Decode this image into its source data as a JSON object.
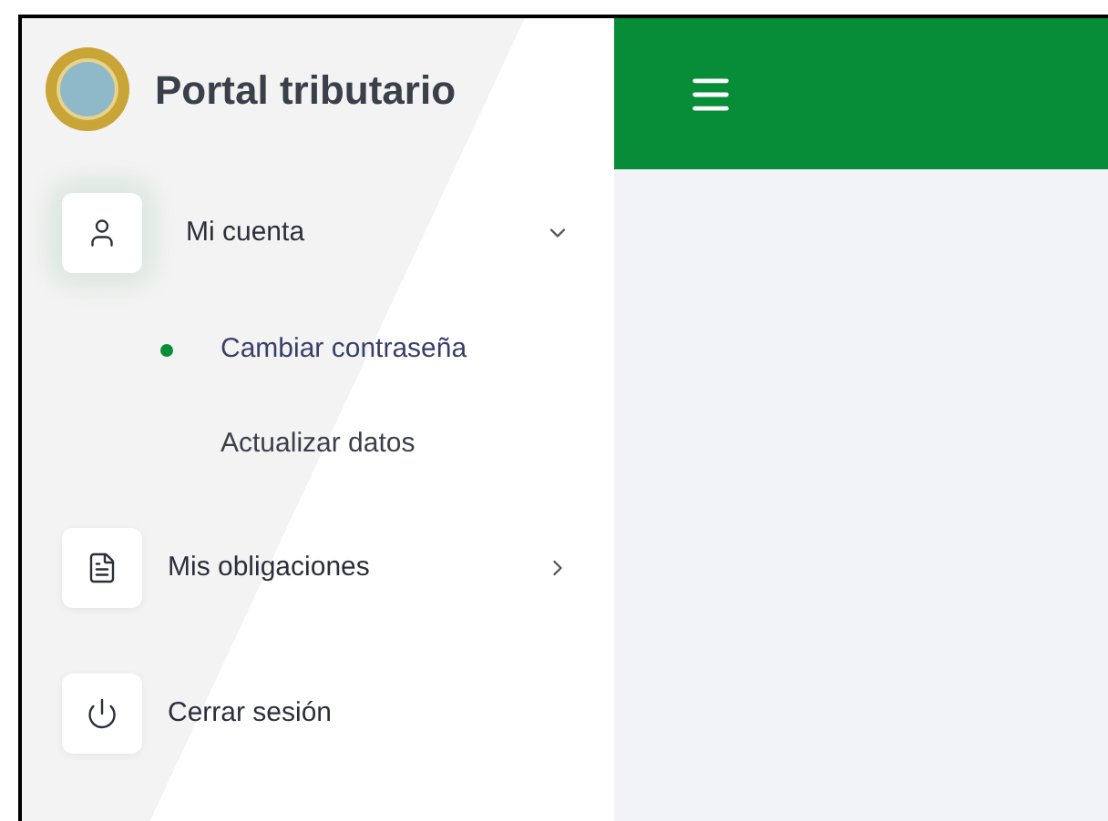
{
  "sidebar": {
    "title": "Portal tributario",
    "items": [
      {
        "label": "Mi cuenta",
        "kind": "group",
        "expanded": true,
        "children": [
          {
            "label": "Cambiar contraseña",
            "selected": true
          },
          {
            "label": "Actualizar datos",
            "selected": false
          }
        ]
      },
      {
        "label": "Mis obligaciones",
        "kind": "group",
        "expanded": false
      },
      {
        "label": "Cerrar sesión",
        "kind": "link"
      }
    ]
  }
}
